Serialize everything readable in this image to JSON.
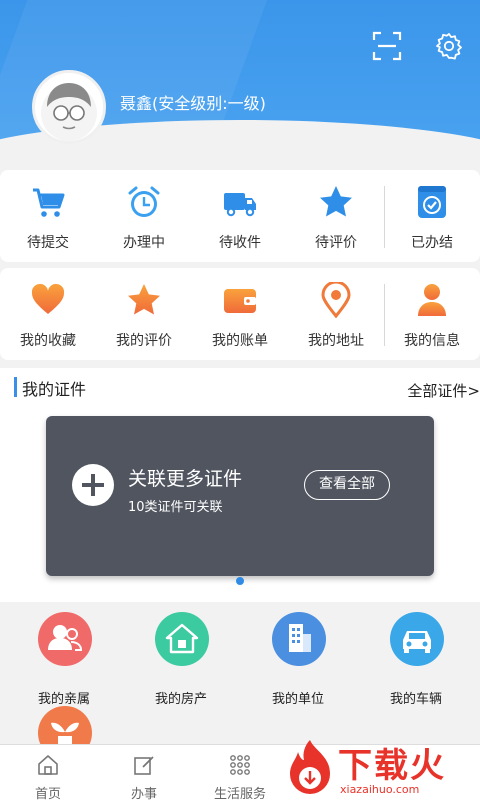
{
  "header": {
    "user_name": "聂鑫(安全级别:一级)",
    "accent_color": "#3b95ea",
    "icons": [
      "scan-icon",
      "gear-icon",
      "avatar"
    ]
  },
  "orders": [
    {
      "label": "待提交",
      "icon": "cart-icon"
    },
    {
      "label": "办理中",
      "icon": "alarm-clock-icon"
    },
    {
      "label": "待收件",
      "icon": "truck-icon"
    },
    {
      "label": "待评价",
      "icon": "star-icon"
    },
    {
      "label": "已办结",
      "icon": "check-file-icon"
    }
  ],
  "profile": [
    {
      "label": "我的收藏",
      "icon": "heart-icon"
    },
    {
      "label": "我的评价",
      "icon": "star-icon"
    },
    {
      "label": "我的账单",
      "icon": "wallet-icon"
    },
    {
      "label": "我的地址",
      "icon": "location-pin-icon"
    },
    {
      "label": "我的信息",
      "icon": "person-icon"
    }
  ],
  "certificates": {
    "title": "我的证件",
    "all_link": "全部证件>",
    "card_main": "关联更多证件",
    "card_sub": "10类证件可关联",
    "view_all": "查看全部"
  },
  "mine": [
    {
      "label": "我的亲属",
      "icon": "family-icon",
      "color": "#f06a6a"
    },
    {
      "label": "我的房产",
      "icon": "house-icon",
      "color": "#3ccaa0"
    },
    {
      "label": "我的单位",
      "icon": "building-icon",
      "color": "#4a8fe0"
    },
    {
      "label": "我的车辆",
      "icon": "car-icon",
      "color": "#3aa7e8"
    }
  ],
  "tabs": [
    {
      "label": "首页",
      "icon": "home-icon"
    },
    {
      "label": "办事",
      "icon": "edit-icon"
    },
    {
      "label": "生活服务",
      "icon": "grid-icon"
    }
  ],
  "watermark": {
    "main": "下载火",
    "sub": "xiazaihuo.com"
  }
}
